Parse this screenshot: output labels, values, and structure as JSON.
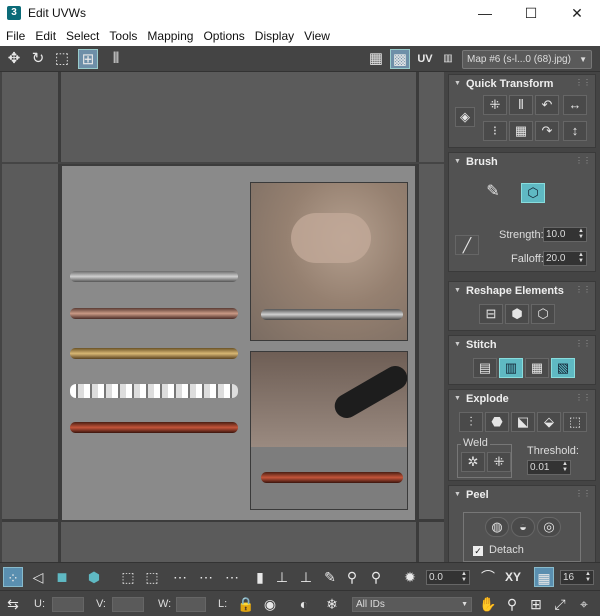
{
  "window": {
    "title": "Edit UVWs",
    "app_icon": "3",
    "minimize": "—",
    "maximize": "☐",
    "close": "✕"
  },
  "menu": [
    "File",
    "Edit",
    "Select",
    "Tools",
    "Mapping",
    "Options",
    "Display",
    "View"
  ],
  "top_toolbar": {
    "uv_label": "UV",
    "map_selector": "Map #6 (s-l...0 (68).jpg)"
  },
  "sidebar": {
    "quick_transform": {
      "title": "Quick Transform"
    },
    "brush": {
      "title": "Brush",
      "strength_label": "Strength:",
      "strength_value": "10.0",
      "falloff_label": "Falloff:",
      "falloff_value": "20.0"
    },
    "reshape": {
      "title": "Reshape Elements"
    },
    "stitch": {
      "title": "Stitch"
    },
    "explode": {
      "title": "Explode",
      "weld_label": "Weld",
      "threshold_label": "Threshold:",
      "threshold_value": "0.01"
    },
    "peel": {
      "title": "Peel",
      "detach_label": "Detach"
    }
  },
  "bottom_toolbar": {
    "rotate_value": "0.0",
    "axis_label": "XY",
    "grid_value": "16"
  },
  "status": {
    "u_label": "U:",
    "v_label": "V:",
    "w_label": "W:",
    "l_label": "L:",
    "id_filter": "All IDs"
  },
  "colors": {
    "accent": "#5fb9c3",
    "active": "#6e8fa8",
    "bg": "#444444"
  }
}
